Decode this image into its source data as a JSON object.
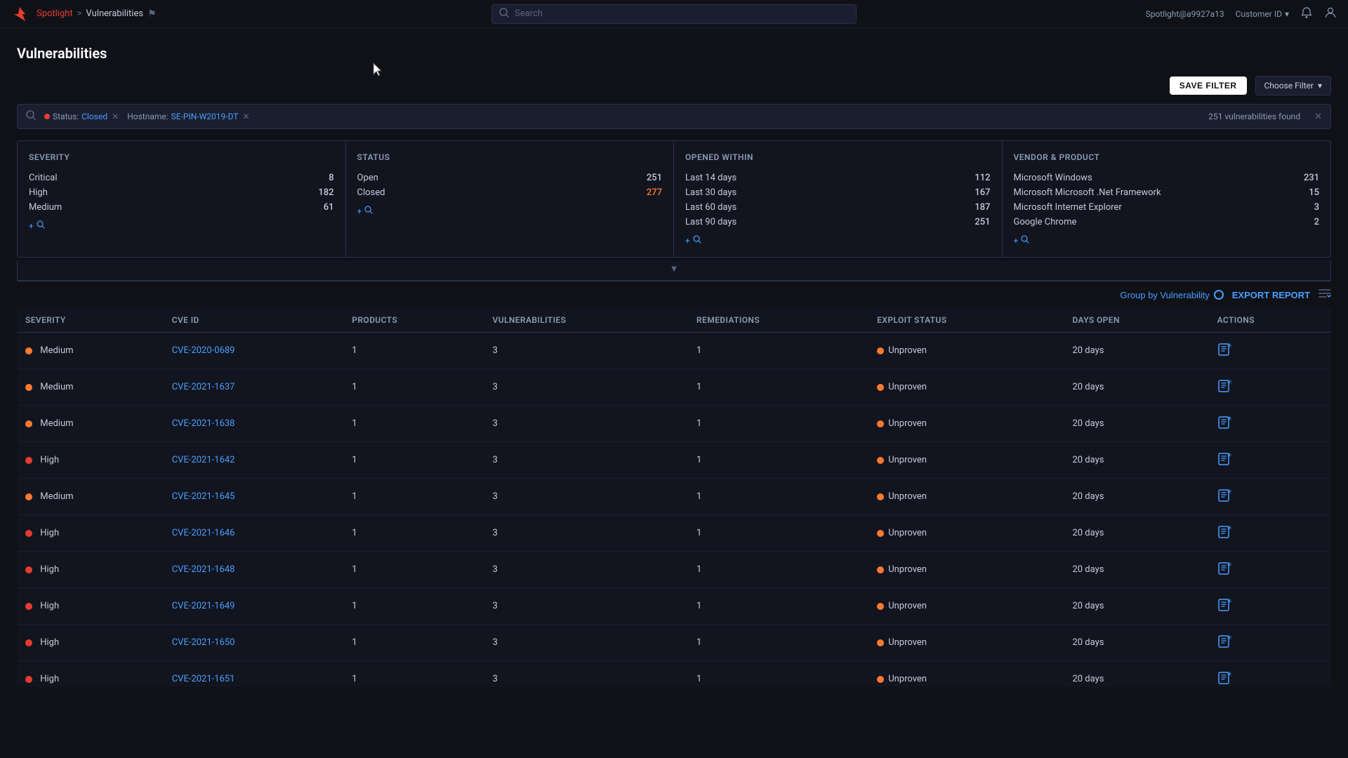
{
  "app": {
    "logo_icon": "falcon",
    "nav_title": "Spotlight",
    "nav_separator": ">",
    "nav_current": "Vulnerabilities",
    "search_placeholder": "Search",
    "user": "Spotlight@a9927a13",
    "customer_label": "Customer ID"
  },
  "filters": {
    "save_btn": "SAVE FILTER",
    "choose_btn": "Choose Filter",
    "active": [
      {
        "label": "Status:",
        "value": "Closed",
        "type": "dot"
      },
      {
        "label": "Hostname:",
        "value": "SE-PIN-W2019-DT"
      }
    ],
    "count_text": "251 vulnerabilities found"
  },
  "summary": {
    "severity": {
      "title": "Severity",
      "items": [
        {
          "label": "Critical",
          "count": "8"
        },
        {
          "label": "High",
          "count": "182"
        },
        {
          "label": "Medium",
          "count": "61"
        }
      ]
    },
    "status": {
      "title": "Status",
      "items": [
        {
          "label": "Open",
          "count": "251",
          "color": "normal"
        },
        {
          "label": "Closed",
          "count": "277",
          "color": "orange"
        }
      ]
    },
    "opened_within": {
      "title": "Opened within",
      "items": [
        {
          "label": "Last 14 days",
          "count": "112"
        },
        {
          "label": "Last 30 days",
          "count": "167"
        },
        {
          "label": "Last 60 days",
          "count": "187"
        },
        {
          "label": "Last 90 days",
          "count": "251"
        }
      ]
    },
    "vendor": {
      "title": "Vendor & product",
      "items": [
        {
          "label": "Microsoft Windows",
          "count": "231"
        },
        {
          "label": "Microsoft Microsoft .Net Framework",
          "count": "15"
        },
        {
          "label": "Microsoft Internet Explorer",
          "count": "3"
        },
        {
          "label": "Google Chrome",
          "count": "2"
        }
      ]
    }
  },
  "table": {
    "group_by_label": "Group by Vulnerability",
    "export_label": "EXPORT REPORT",
    "columns": [
      "Severity",
      "CVE ID",
      "Products",
      "Vulnerabilities",
      "Remediations",
      "Exploit status",
      "Days open",
      "Actions"
    ],
    "rows": [
      {
        "severity": "Medium",
        "severity_type": "medium",
        "cve": "CVE-2020-0689",
        "products": "1",
        "vulnerabilities": "3",
        "remediations": "1",
        "exploit": "Unproven",
        "days": "20 days"
      },
      {
        "severity": "Medium",
        "severity_type": "medium",
        "cve": "CVE-2021-1637",
        "products": "1",
        "vulnerabilities": "3",
        "remediations": "1",
        "exploit": "Unproven",
        "days": "20 days"
      },
      {
        "severity": "Medium",
        "severity_type": "medium",
        "cve": "CVE-2021-1638",
        "products": "1",
        "vulnerabilities": "3",
        "remediations": "1",
        "exploit": "Unproven",
        "days": "20 days"
      },
      {
        "severity": "High",
        "severity_type": "high",
        "cve": "CVE-2021-1642",
        "products": "1",
        "vulnerabilities": "3",
        "remediations": "1",
        "exploit": "Unproven",
        "days": "20 days"
      },
      {
        "severity": "Medium",
        "severity_type": "medium",
        "cve": "CVE-2021-1645",
        "products": "1",
        "vulnerabilities": "3",
        "remediations": "1",
        "exploit": "Unproven",
        "days": "20 days"
      },
      {
        "severity": "High",
        "severity_type": "high",
        "cve": "CVE-2021-1646",
        "products": "1",
        "vulnerabilities": "3",
        "remediations": "1",
        "exploit": "Unproven",
        "days": "20 days"
      },
      {
        "severity": "High",
        "severity_type": "high",
        "cve": "CVE-2021-1648",
        "products": "1",
        "vulnerabilities": "3",
        "remediations": "1",
        "exploit": "Unproven",
        "days": "20 days"
      },
      {
        "severity": "High",
        "severity_type": "high",
        "cve": "CVE-2021-1649",
        "products": "1",
        "vulnerabilities": "3",
        "remediations": "1",
        "exploit": "Unproven",
        "days": "20 days"
      },
      {
        "severity": "High",
        "severity_type": "high",
        "cve": "CVE-2021-1650",
        "products": "1",
        "vulnerabilities": "3",
        "remediations": "1",
        "exploit": "Unproven",
        "days": "20 days"
      },
      {
        "severity": "High",
        "severity_type": "high",
        "cve": "CVE-2021-1651",
        "products": "1",
        "vulnerabilities": "3",
        "remediations": "1",
        "exploit": "Unproven",
        "days": "20 days"
      }
    ]
  }
}
